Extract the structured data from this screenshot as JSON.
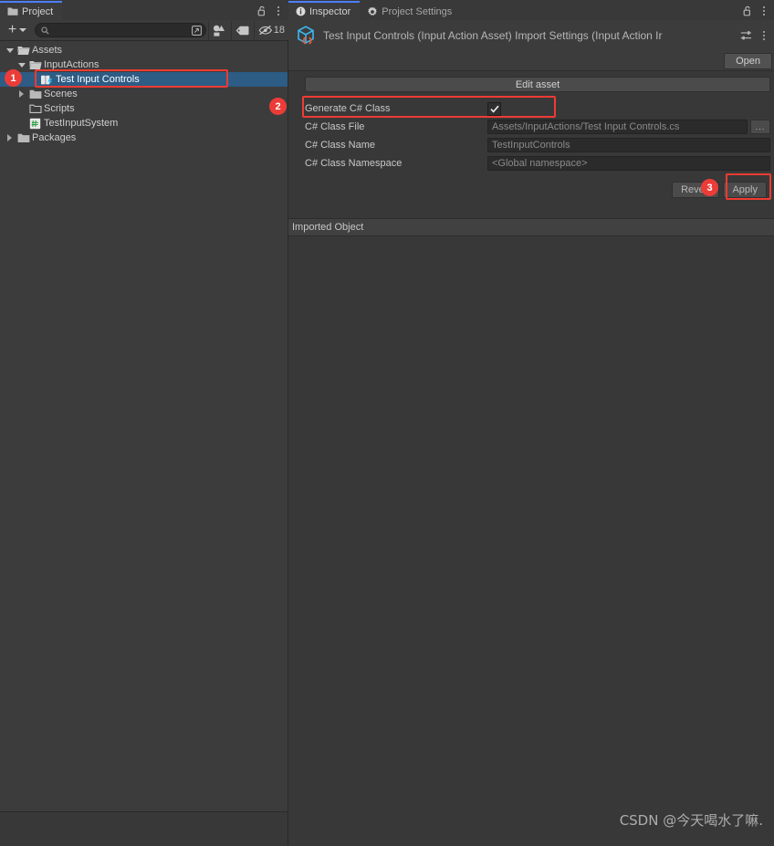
{
  "project_panel": {
    "tab_label": "Project",
    "tab_icon": "folder-icon",
    "lock_icon": "lock-open-icon",
    "menu_icon": "kebab-menu-icon",
    "toolbar": {
      "create_label": "+",
      "create_icon": "plus-icon",
      "create_dropdown_icon": "chevron-down-icon",
      "search_icon": "search-icon",
      "search_value": "",
      "search_placeholder": "",
      "filter_by_type_icon": "asset-type-filter-icon",
      "filter_by_label_icon": "label-tag-icon",
      "hidden_packages_icon": "eye-slash-icon",
      "hidden_packages_count": "18"
    },
    "tree": [
      {
        "label": "Assets",
        "icon": "folder-open-icon",
        "indent": 0,
        "twisty": "expanded",
        "selected": false
      },
      {
        "label": "InputActions",
        "icon": "folder-open-icon",
        "indent": 1,
        "twisty": "expanded",
        "selected": false
      },
      {
        "label": "Test Input Controls",
        "icon": "input-action-asset-icon",
        "indent": 2,
        "twisty": "none",
        "selected": true
      },
      {
        "label": "Scenes",
        "icon": "folder-icon",
        "indent": 1,
        "twisty": "collapsed",
        "selected": false
      },
      {
        "label": "Scripts",
        "icon": "folder-outline-icon",
        "indent": 1,
        "twisty": "none",
        "selected": false
      },
      {
        "label": "TestInputSystem",
        "icon": "csharp-script-icon",
        "indent": 1,
        "twisty": "none",
        "selected": false
      },
      {
        "label": "Packages",
        "icon": "folder-icon",
        "indent": 0,
        "twisty": "collapsed",
        "selected": false
      }
    ]
  },
  "inspector": {
    "tabs": [
      {
        "label": "Inspector",
        "icon": "info-icon",
        "active": true
      },
      {
        "label": "Project Settings",
        "icon": "gear-icon",
        "active": false
      }
    ],
    "lock_icon": "lock-open-icon",
    "menu_icon": "kebab-menu-icon",
    "asset_icon": "input-action-asset-icon",
    "asset_title": "Test Input Controls (Input Action Asset) Import Settings (Input Action Ir",
    "preset_icon": "preset-sliders-icon",
    "header_menu_icon": "kebab-menu-icon",
    "open_button": "Open",
    "edit_asset_button": "Edit asset",
    "properties": [
      {
        "label": "Generate C# Class",
        "type": "checkbox",
        "checked": true,
        "check_glyph": "checkmark-icon"
      },
      {
        "label": "C# Class File",
        "type": "text",
        "value": "Assets/InputActions/Test Input Controls.cs",
        "browse_label": "...",
        "browse_icon": "ellipsis-icon"
      },
      {
        "label": "C# Class Name",
        "type": "text",
        "value": "TestInputControls"
      },
      {
        "label": "C# Class Namespace",
        "type": "text",
        "value": "<Global namespace>"
      }
    ],
    "revert_button": "Revert",
    "apply_button": "Apply",
    "imported_object_label": "Imported Object"
  },
  "annotations": [
    {
      "badge": "1",
      "target": "project-tree-selected-asset"
    },
    {
      "badge": "2",
      "target": "generate-csharp-class-row"
    },
    {
      "badge": "3",
      "target": "apply-button"
    }
  ],
  "watermark": "CSDN @今天喝水了嘛.",
  "colors": {
    "panel_bg": "#383838",
    "header_bg": "#3c3c3c",
    "tab_accent": "#4c7eff",
    "selection_blue": "#2d5c85",
    "annotation_red": "#ec3c38",
    "field_bg": "#2b2b2b",
    "button_bg": "#4b4b4b",
    "text": "#c9c9c9",
    "text_dim": "#8e8e8e"
  }
}
